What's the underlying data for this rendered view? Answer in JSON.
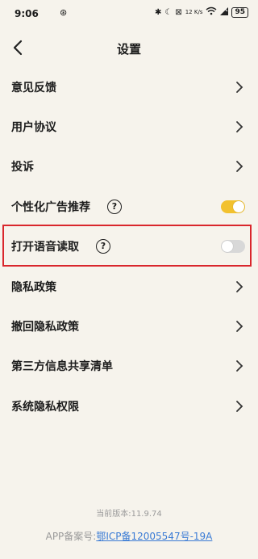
{
  "status_bar": {
    "time": "9:06",
    "app_icon": "⊛",
    "icons": [
      "✱",
      "☾",
      "⊠"
    ],
    "net_speed_value": "12",
    "net_speed_unit": "K/s",
    "wifi": "wifi-icon",
    "battery": "95"
  },
  "header": {
    "title": "设置"
  },
  "settings": {
    "items": [
      {
        "label": "意见反馈"
      },
      {
        "label": "用户协议"
      },
      {
        "label": "投诉"
      },
      {
        "label": "个性化广告推荐",
        "help": "?",
        "toggle": true
      },
      {
        "label": "打开语音读取",
        "help": "?",
        "toggle": false
      },
      {
        "label": "隐私政策"
      },
      {
        "label": "撤回隐私政策"
      },
      {
        "label": "第三方信息共享清单"
      },
      {
        "label": "系统隐私权限"
      }
    ]
  },
  "footer": {
    "version": "当前版本:11.9.74",
    "icp_prefix": "APP备案号:",
    "icp_link": "鄂ICP备12005547号-19A"
  },
  "colors": {
    "background": "#f6f3ec",
    "toggle_on": "#f2c12e",
    "toggle_off": "#d8d8d8",
    "highlight": "#d9262c",
    "link": "#3a7bd5"
  }
}
